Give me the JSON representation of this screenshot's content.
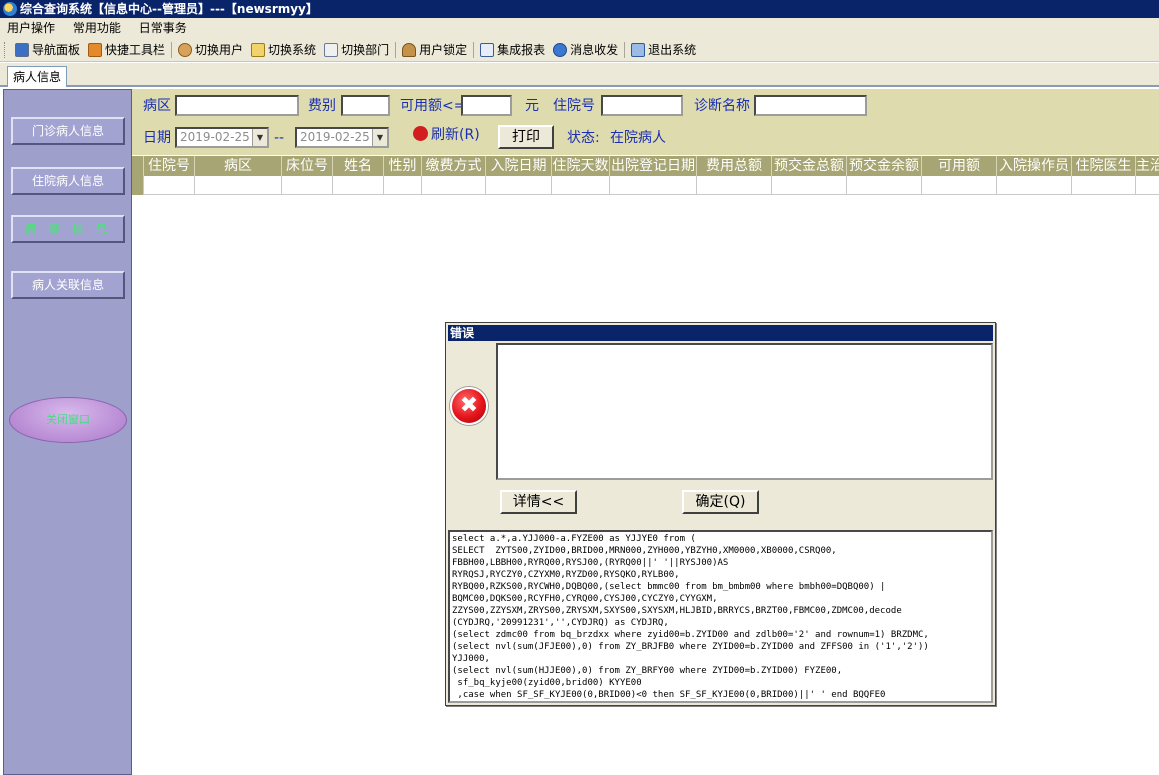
{
  "window": {
    "title": "综合查询系统【信息中心--管理员】---【newsrmyy】"
  },
  "menu": [
    "用户操作",
    "常用功能",
    "日常事务"
  ],
  "toolbar": {
    "nav_panel": "导航面板",
    "quick_toolbar": "快捷工具栏",
    "switch_user": "切换用户",
    "switch_system": "切换系统",
    "switch_dept": "切换部门",
    "user_lock": "用户锁定",
    "integrated_report": "集成报表",
    "messages": "消息收发",
    "exit": "退出系统"
  },
  "tab": {
    "label": "病人信息"
  },
  "sidebar": {
    "outpatient": "门诊病人信息",
    "inpatient": "住院病人信息",
    "hidden_item": "病 案 信 息",
    "related": "病人关联信息",
    "ellipse_button": "关闭窗口"
  },
  "filters": {
    "ward_label": "病区",
    "ward_value": "",
    "fee_type_label": "费别",
    "fee_type_value": "",
    "available_label": "可用额<=",
    "available_value": "",
    "yuan": "元",
    "inpatient_no_label": "住院号",
    "inpatient_no_value": "",
    "diagnosis_label": "诊断名称",
    "diagnosis_value": "",
    "date_label": "日期",
    "date_from": "2019-02-25",
    "date_sep": "--",
    "date_to": "2019-02-25",
    "refresh_button": "刷新(R)",
    "print_button": "打印",
    "status_label": "状态:",
    "status_value": "在院病人"
  },
  "grid": {
    "columns": [
      "住院号",
      "病区",
      "床位号",
      "姓名",
      "性别",
      "缴费方式",
      "入院日期",
      "住院天数",
      "出院登记日期",
      "费用总额",
      "预交金总额",
      "预交金余额",
      "可用额",
      "入院操作员",
      "住院医生",
      "主治"
    ]
  },
  "dialog": {
    "title": "错误",
    "message": "",
    "detail_button": "详情<<",
    "ok_button": "确定(Q)",
    "sql_text": "select a.*,a.YJJ000-a.FYZE00 as YJJYE0 from (\nSELECT  ZYTS00,ZYID00,BRID00,MRN000,ZYH000,YBZYH0,XM0000,XB0000,CSRQ00,\nFBBH00,LBBH00,RYRQ00,RYSJ00,(RYRQ00||' '||RYSJ00)AS\nRYRQSJ,RYCZY0,CZYXM0,RYZD00,RYSQKO,RYLB00,\nRYBQ00,RZKS00,RYCWH0,DQBQ00,(select bmmc00 from bm_bmbm00 where bmbh00=DQBQ00) |\nBQMC00,DQKS00,RCYFH0,CYRQ00,CYSJ00,CYCZY0,CYYGXM,\nZZYS00,ZZYSXM,ZRYS00,ZRYSXM,SXYS00,SXYSXM,HLJBID,BRRYCS,BRZT00,FBMC00,ZDMC00,decode\n(CYDJRQ,'20991231','',CYDJRQ) as CYDJRQ,\n(select zdmc00 from bq_brzdxx where zyid00=b.ZYID00 and zdlb00='2' and rownum=1) BRZDMC,\n(select nvl(sum(JFJE00),0) from ZY_BRJFB0 where ZYID00=b.ZYID00 and ZFFS00 in ('1','2'))\nYJJ000,\n(select nvl(sum(HJJE00),0) from ZY_BRFY00 where ZYID00=b.ZYID00) FYZE00,\n sf_bq_kyje00(zyid00,brid00) KYYE00\n ,case when SF_SF_KYJE00(0,BRID00)<0 then SF_SF_KYJE00(0,BRID00)||' ' end BQQFE0"
  }
}
